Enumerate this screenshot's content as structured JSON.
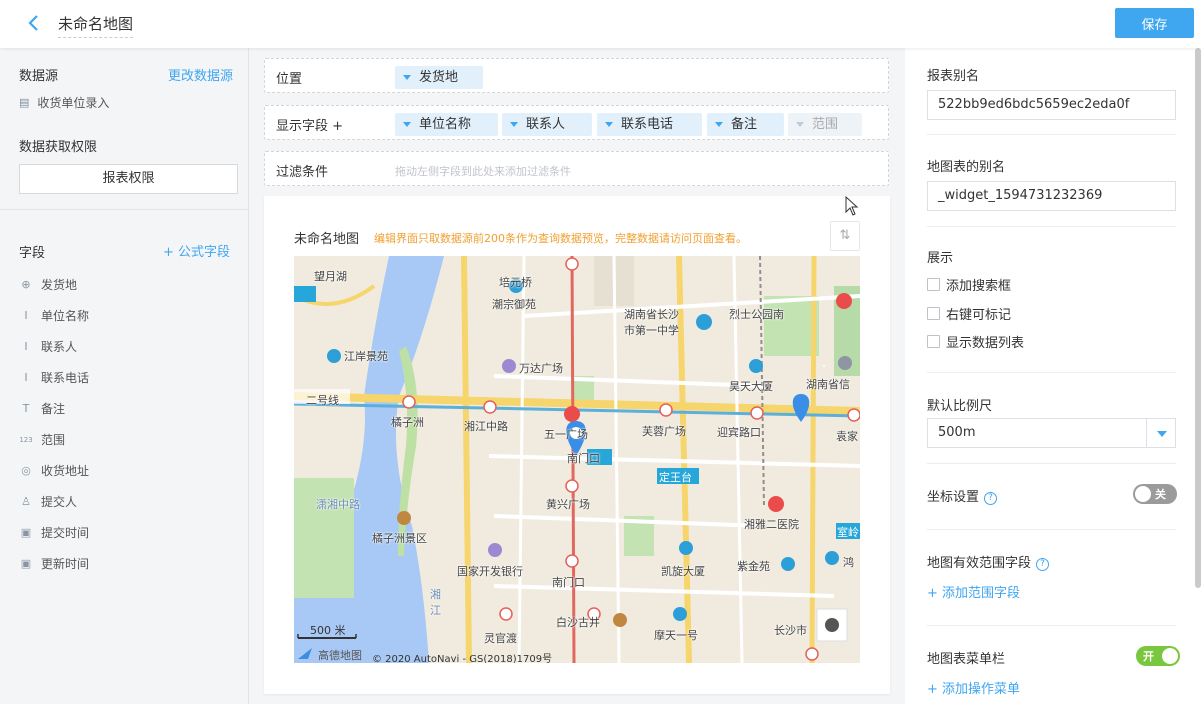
{
  "header": {
    "title": "未命名地图",
    "save_label": "保存"
  },
  "left": {
    "datasource_title": "数据源",
    "change_link": "更改数据源",
    "datasource_item": "收货单位录入",
    "permission_title": "数据获取权限",
    "permission_button": "报表权限",
    "fields_title": "字段",
    "formula_link": "+ 公式字段",
    "fields": [
      {
        "icon": "location-icon",
        "glyph": "⊕",
        "label": "发货地"
      },
      {
        "icon": "text-icon",
        "glyph": "I",
        "label": "单位名称"
      },
      {
        "icon": "text-icon",
        "glyph": "I",
        "label": "联系人"
      },
      {
        "icon": "text-icon",
        "glyph": "I",
        "label": "联系电话"
      },
      {
        "icon": "textarea-icon",
        "glyph": "T",
        "label": "备注"
      },
      {
        "icon": "number-icon",
        "glyph": "123",
        "label": "范围"
      },
      {
        "icon": "map-pin-icon",
        "glyph": "◎",
        "label": "收货地址"
      },
      {
        "icon": "user-icon",
        "glyph": "♙",
        "label": "提交人"
      },
      {
        "icon": "calendar-icon",
        "glyph": "▣",
        "label": "提交时间"
      },
      {
        "icon": "calendar-icon",
        "glyph": "▣",
        "label": "更新时间"
      }
    ]
  },
  "center": {
    "position_label": "位置",
    "position_chip": "发货地",
    "display_label": "显示字段 +",
    "display_chips": [
      "单位名称",
      "联系人",
      "联系电话",
      "备注",
      "范围"
    ],
    "filter_label": "过滤条件",
    "filter_hint": "拖动左侧字段到此处来添加过滤条件",
    "map_title": "未命名地图",
    "map_warning": "编辑界面只取数据源前200条作为查询数据预览，完整数据请访问页面查看。",
    "sort_glyph": "⇅",
    "map_labels": [
      "望月湖",
      "培元桥",
      "潮宗御苑",
      "湖南省长沙",
      "市第一中学",
      "烈士公园南",
      "江岸景苑",
      "万达广场",
      "昊天大厦",
      "湖南省信",
      "橘子洲",
      "湘江中路",
      "五一广场",
      "芙蓉广场",
      "迎宾路口",
      "袁家",
      "南门口",
      "定王台",
      "黄兴广场",
      "湘雅二医院",
      "橘子洲景区",
      "国家开发银行",
      "凯旋大厦",
      "紫金苑",
      "南门口",
      "白沙古井",
      "灵官渡",
      "摩天一号",
      "长沙市",
      "湘",
      "江",
      "二号线",
      "潇湘中路",
      "室岭",
      "鸿"
    ],
    "scale_label": "500 米",
    "map_brand": "高德地图",
    "copyright": "© 2020 AutoNavi - GS(2018)1709号"
  },
  "right": {
    "alias_label": "报表别名",
    "alias_value": "522bb9ed6bdc5659ec2eda0f",
    "widget_alias_label": "地图表的别名",
    "widget_alias_value": "_widget_1594731232369",
    "display_label": "展示",
    "options": [
      "添加搜索框",
      "右键可标记",
      "显示数据列表"
    ],
    "scale_label": "默认比例尺",
    "scale_value": "500m",
    "coord_label": "坐标设置",
    "coord_toggle": "关",
    "range_label": "地图有效范围字段",
    "range_add": "+ 添加范围字段",
    "menu_label": "地图表菜单栏",
    "menu_toggle": "开",
    "menu_add": "+ 添加操作菜单"
  },
  "colors": {
    "accent": "#3fa6f0",
    "toggle_on": "#78c73e",
    "toggle_off": "#9b9b9b",
    "warning": "#f0a030"
  }
}
